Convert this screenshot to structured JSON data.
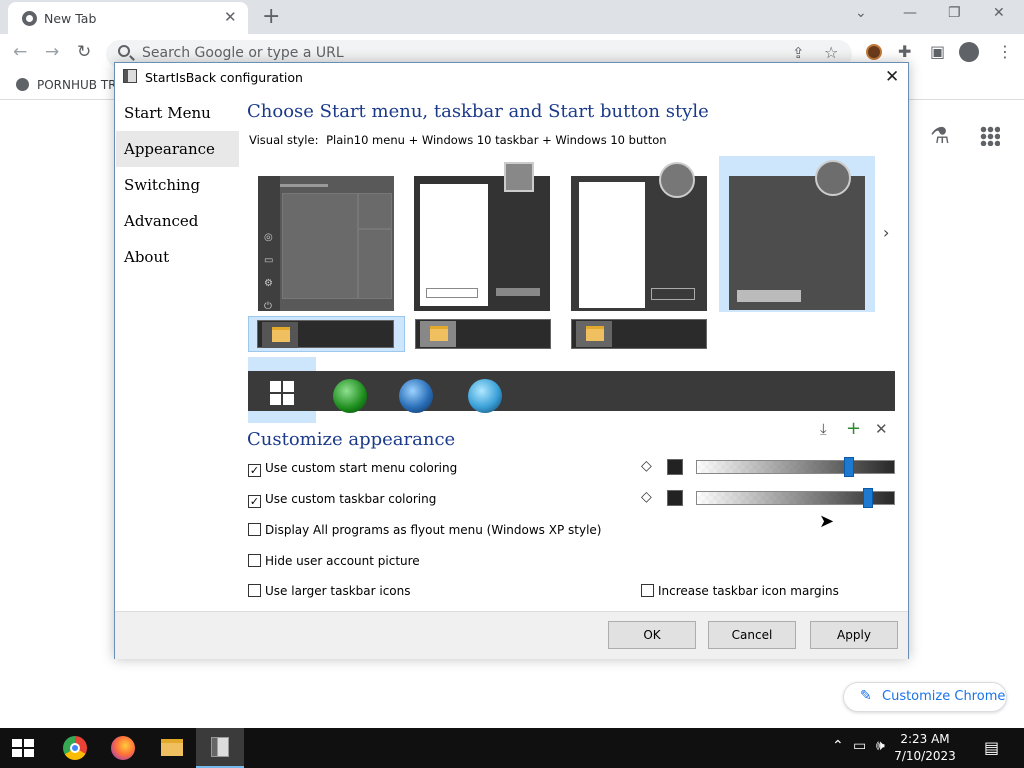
{
  "browser": {
    "tab_title": "New Tab",
    "omnibox_placeholder": "Search Google or type a URL",
    "bookmark_label": "PORNHUB TR",
    "customize_label": "Customize Chrome"
  },
  "dialog": {
    "title": "StartIsBack configuration",
    "nav": [
      "Start Menu",
      "Appearance",
      "Switching",
      "Advanced",
      "About"
    ],
    "selected_nav": "Appearance",
    "heading": "Choose Start menu, taskbar and Start button style",
    "visual_style_label": "Visual style:",
    "visual_style_value": "Plain10 menu + Windows 10 taskbar + Windows 10 button",
    "customize_heading": "Customize appearance",
    "options": {
      "custom_start_coloring": {
        "label": "Use custom start menu coloring",
        "checked": true
      },
      "custom_taskbar_coloring": {
        "label": "Use custom taskbar coloring",
        "checked": true
      },
      "flyout_menu": {
        "label": "Display All programs as flyout menu (Windows XP style)",
        "checked": false
      },
      "hide_user_picture": {
        "label": "Hide user account picture",
        "checked": false
      },
      "larger_icons": {
        "label": "Use larger taskbar icons",
        "checked": false
      },
      "icon_margins": {
        "label": "Increase taskbar icon margins",
        "checked": false
      }
    },
    "sliders": {
      "start_menu_level": 0.78,
      "taskbar_level": 0.88
    },
    "buttons": {
      "ok": "OK",
      "cancel": "Cancel",
      "apply": "Apply"
    }
  },
  "taskbar": {
    "time": "2:23 AM",
    "date": "7/10/2023"
  },
  "colors": {
    "heading": "#1b3a8a",
    "selection": "#cde6fb",
    "slider_knob": "#1e79d0",
    "taskbar": "#101010"
  }
}
